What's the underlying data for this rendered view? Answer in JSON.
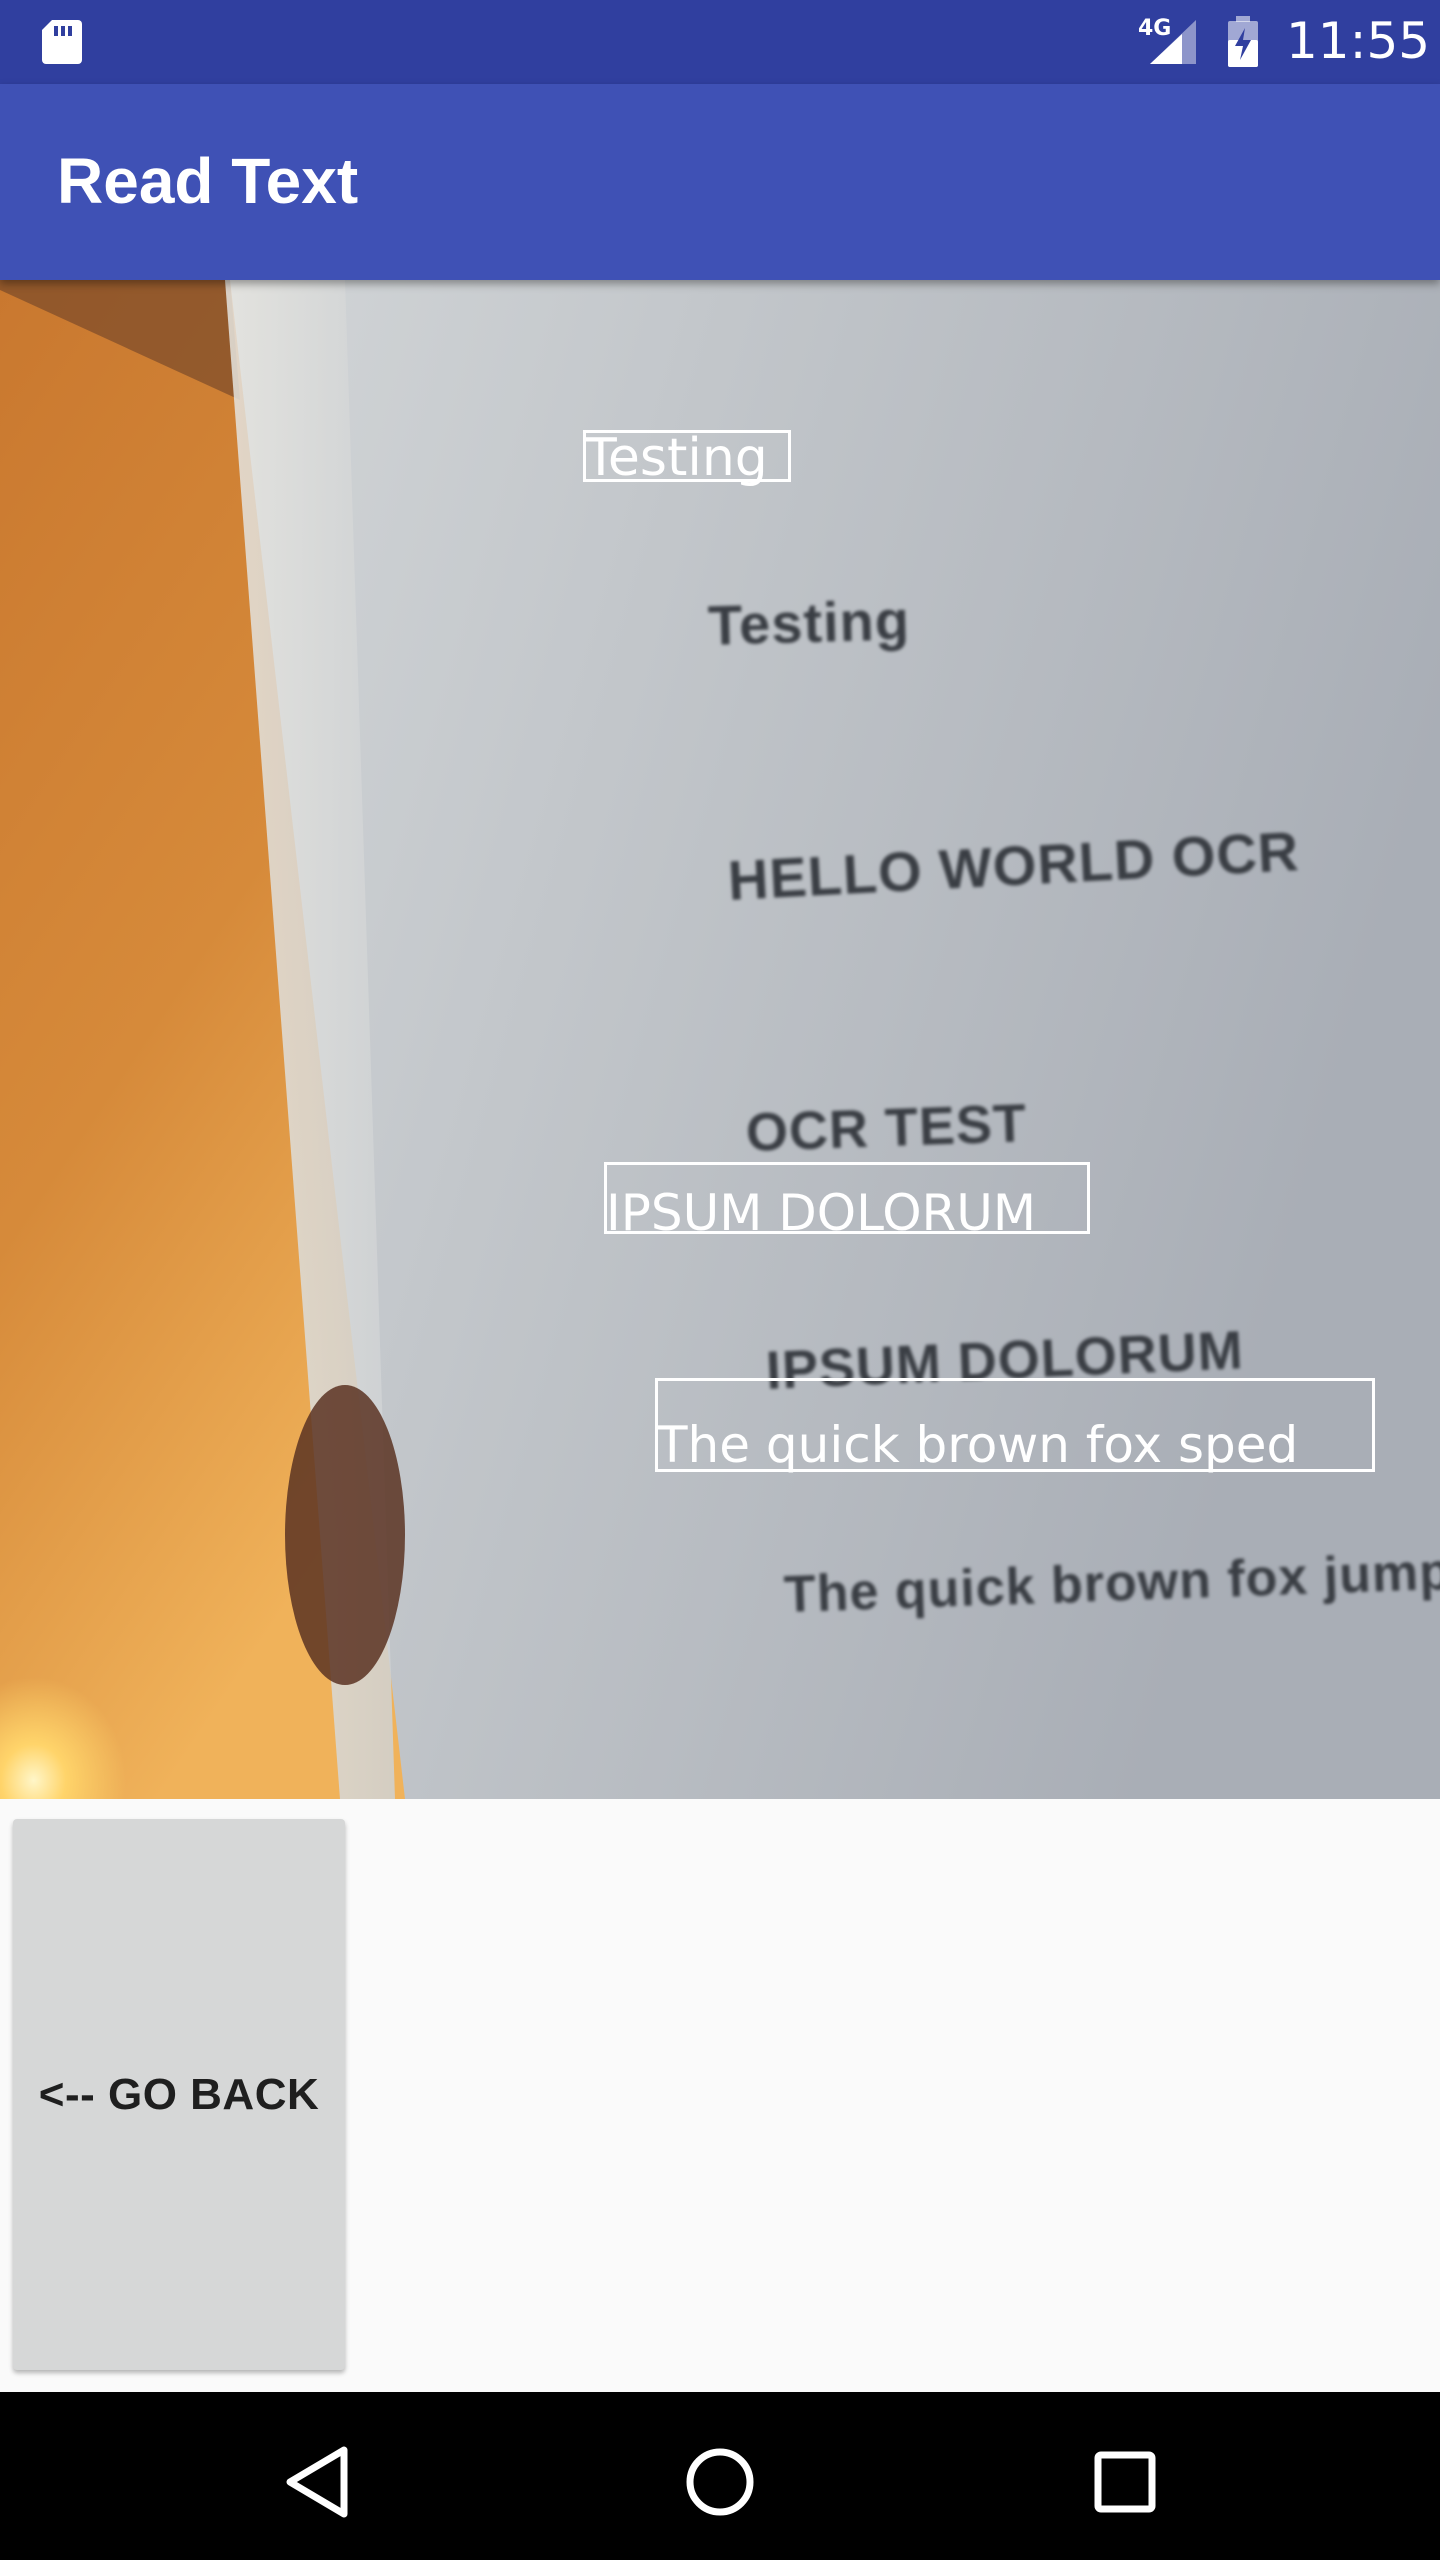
{
  "status_bar": {
    "network_type": "4G",
    "time": "11:55",
    "icons": [
      "sd-card-icon",
      "cellular-signal-icon",
      "battery-charging-icon"
    ]
  },
  "app_bar": {
    "title": "Read Text"
  },
  "camera_preview": {
    "page_text": {
      "line1": "Testing",
      "line2": "HELLO WORLD OCR",
      "line3": "OCR TEST",
      "line4": "IPSUM DOLORUM",
      "line5": "The quick brown fox jumpe"
    },
    "ocr_detections": [
      {
        "text": "Testing"
      },
      {
        "text": "IPSUM DOLORUM"
      },
      {
        "text": "The quick brown fox sped"
      }
    ]
  },
  "actions": {
    "go_back_label": "<-- GO BACK"
  },
  "nav_bar": {
    "buttons": [
      "back-icon",
      "home-icon",
      "recents-icon"
    ]
  },
  "colors": {
    "status_bar": "#303f9f",
    "app_bar": "#3f51b5",
    "background": "#fafafa",
    "button": "#d6d7d7",
    "nav_bar": "#000000",
    "ocr_overlay": "#ffffff"
  }
}
